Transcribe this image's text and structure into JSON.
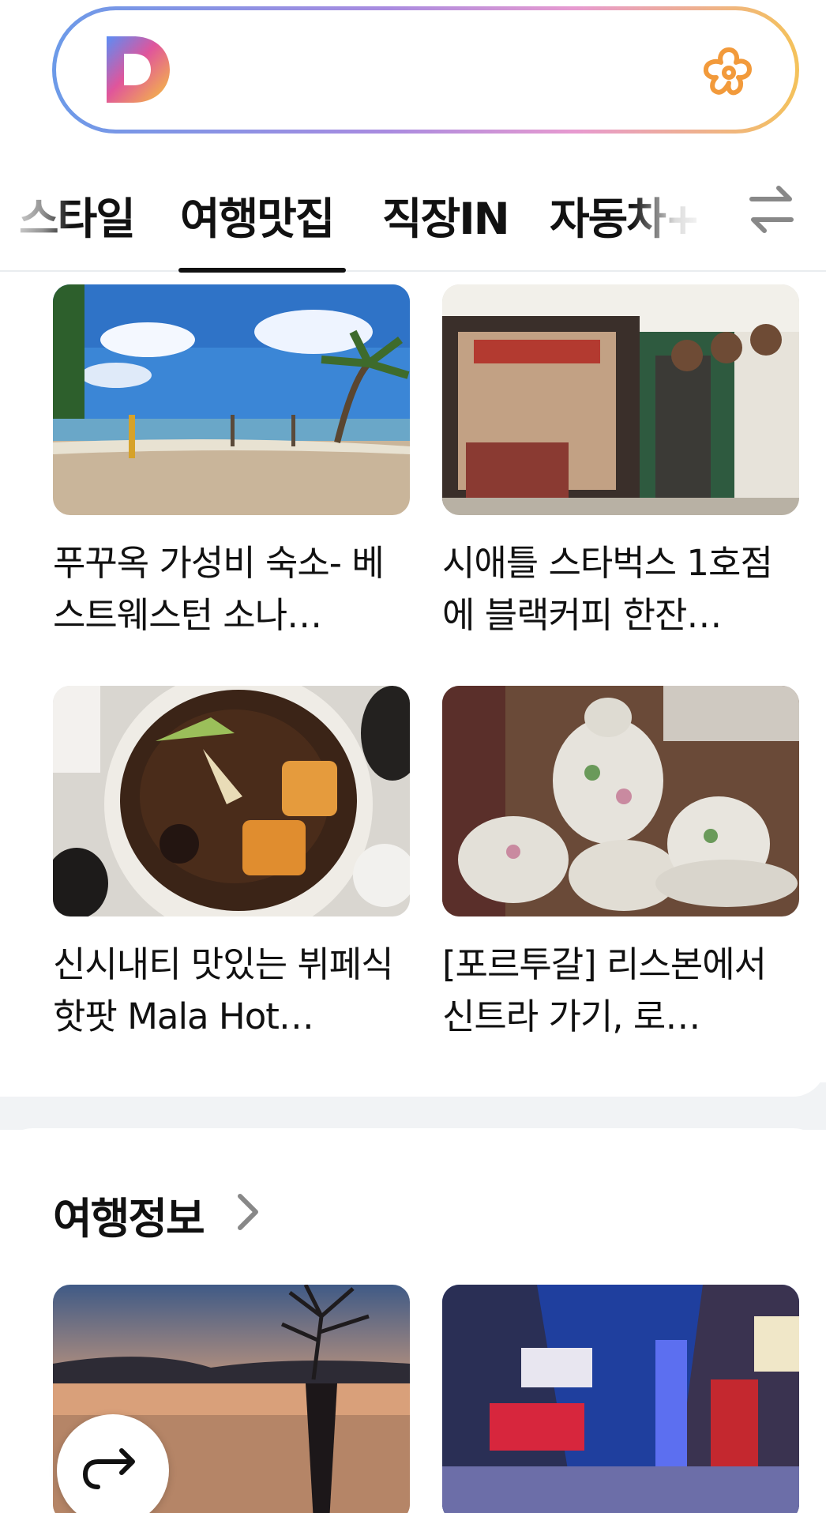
{
  "search": {
    "logo": "D",
    "flower_icon": "flower-icon"
  },
  "tabs": [
    {
      "label": "스타일"
    },
    {
      "label": "여행맛집",
      "active": true
    },
    {
      "label": "직장IN"
    },
    {
      "label": "자동차+"
    }
  ],
  "feed": {
    "cards": [
      {
        "title": "푸꾸옥 가성비 숙소- 베스트웨스턴 소나…"
      },
      {
        "title": "시애틀 스타벅스 1호점에 블랙커피 한잔…"
      },
      {
        "title": "신시내티 맛있는 뷔페식 핫팟 Mala Hot…"
      },
      {
        "title": "[포르투갈] 리스본에서 신트라 가기, 로…"
      }
    ]
  },
  "travel_info": {
    "title": "여행정보",
    "cards": [
      {
        "image": "sunset-lake"
      },
      {
        "image": "times-square"
      }
    ]
  },
  "colors": {
    "accent": "#111111",
    "gradient_start": "#6c9ae8",
    "gradient_end": "#f4c25a",
    "flower": "#f29a3b"
  }
}
